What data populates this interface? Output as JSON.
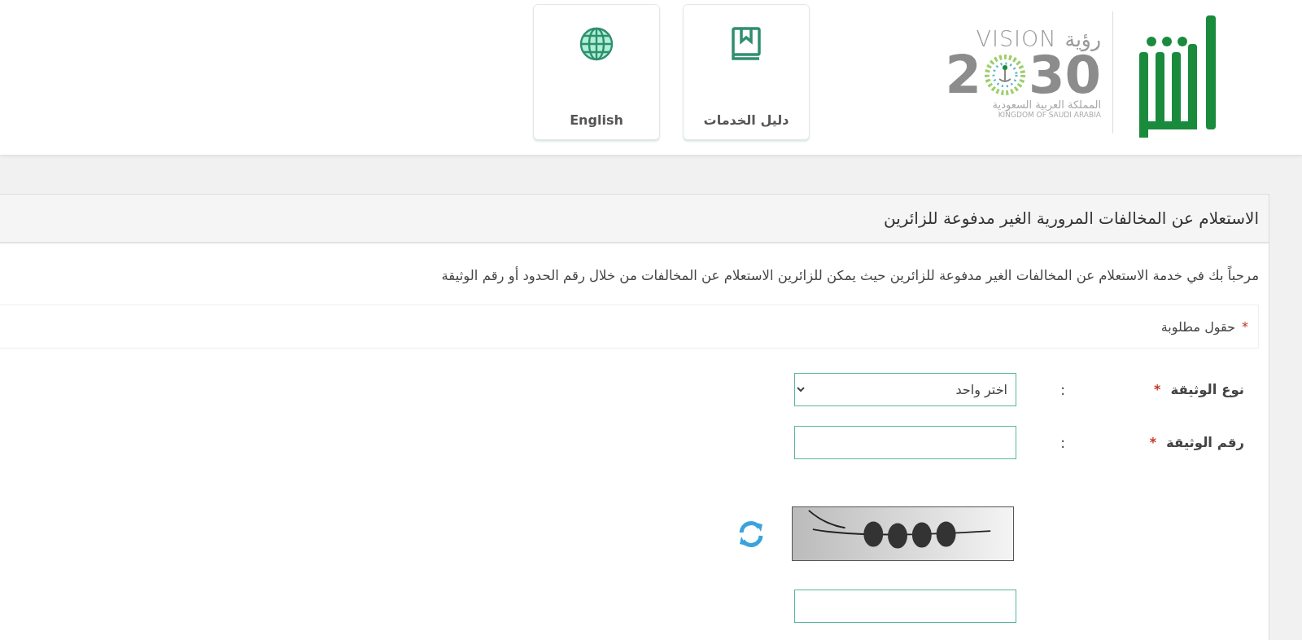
{
  "header": {
    "vision_logo": {
      "word": "VISION",
      "arabic_word": "رؤية",
      "year_start": "2",
      "year_end": "30",
      "country_ar": "المملكة العربية السعودية",
      "country_en": "KINGDOM OF SAUDI ARABIA"
    },
    "nav": [
      {
        "kind": "guide",
        "label": "دليل الخدمات"
      },
      {
        "kind": "language",
        "label": "English"
      }
    ]
  },
  "panel": {
    "title": "الاستعلام عن المخالفات المرورية الغير مدفوعة للزائرين",
    "intro": "مرحباً بك في خدمة الاستعلام عن المخالفات الغير مدفوعة للزائرين حيث يمكن للزائرين الاستعلام عن المخالفات من خلال رقم الحدود أو رقم الوثيقة",
    "required_note": {
      "mark": "*",
      "text": "حقول مطلوبة"
    },
    "fields": [
      {
        "kind": "select",
        "label": "نوع الوثيقة",
        "required_mark": "*",
        "separator": ":",
        "value": "اختر واحد"
      },
      {
        "kind": "text",
        "label": "رقم الوثيقة",
        "required_mark": "*",
        "separator": ":"
      },
      {
        "kind": "captcha"
      },
      {
        "kind": "text"
      }
    ]
  }
}
